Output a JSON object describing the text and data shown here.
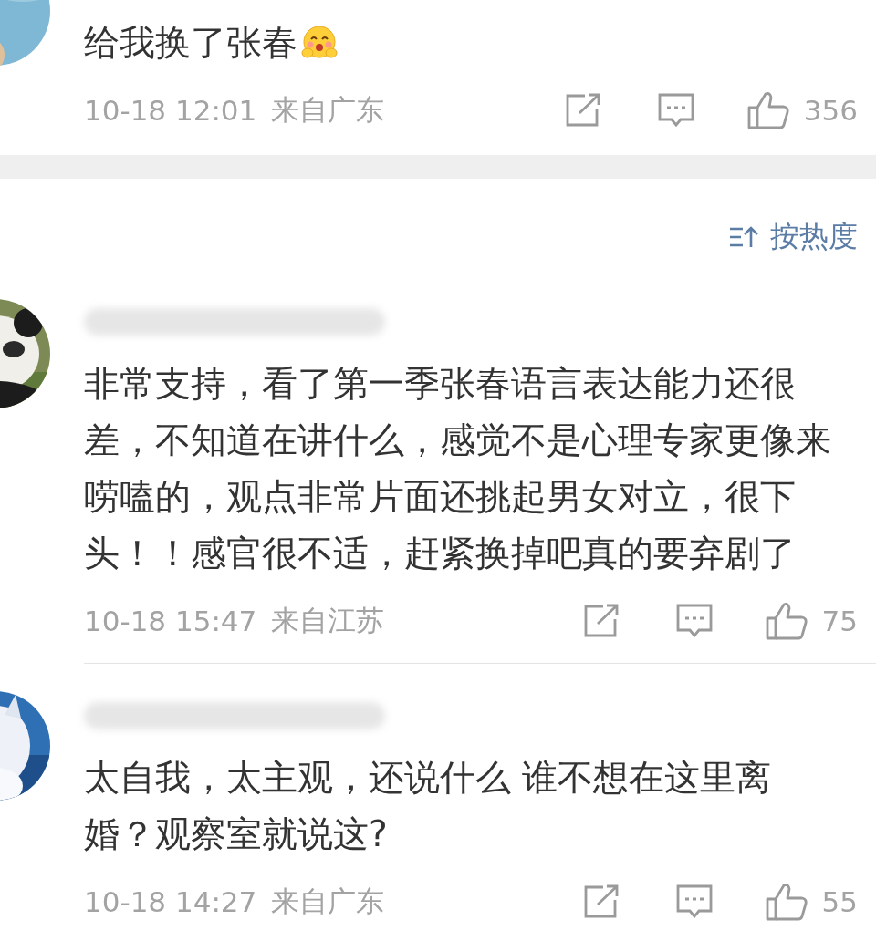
{
  "previous_comment": {
    "name_redacted": false,
    "text": "给我换了张春",
    "trailing_emoji": true,
    "time": "10-18 12:01",
    "location": "来自广东",
    "likes": "356"
  },
  "sort_button": {
    "label": "按热度"
  },
  "comments": [
    {
      "name_redacted": true,
      "text": "非常支持，看了第一季张春语言表达能力还很差，不知道在讲什么，感觉不是心理专家更像来唠嗑的，观点非常片面还挑起男女对立，很下头！！感官很不适，赶紧换掉吧真的要弃剧了",
      "trailing_emoji": false,
      "time": "10-18 15:47",
      "location": "来自江苏",
      "likes": "75"
    },
    {
      "name_redacted": true,
      "text": "太自我，太主观，还说什么 谁不想在这里离婚？观察室就说这?",
      "trailing_emoji": false,
      "time": "10-18 14:27",
      "location": "来自广东",
      "likes": "55"
    }
  ]
}
